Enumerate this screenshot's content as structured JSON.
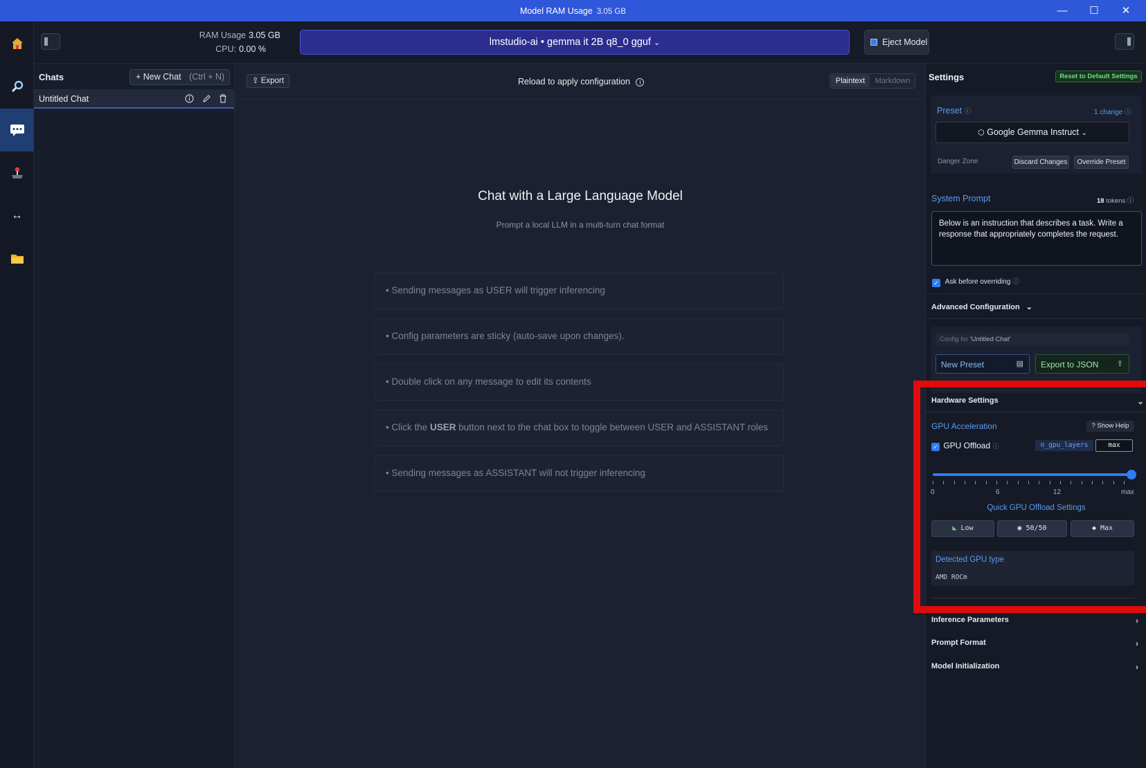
{
  "window": {
    "title": "Model RAM Usage",
    "title_value": "3.05 GB",
    "minimize": "—",
    "maximize": "☐",
    "close": "✕"
  },
  "topbar": {
    "ram_label": "RAM Usage",
    "ram_value": "3.05 GB",
    "cpu_label": "CPU:",
    "cpu_value": "0.00 %",
    "model": "lmstudio-ai • gemma it 2B q8_0 gguf",
    "eject": "Eject Model"
  },
  "chats": {
    "title": "Chats",
    "new_chat": "+ New Chat",
    "shortcut": "(Ctrl + N)",
    "items": [
      {
        "label": "Untitled Chat"
      }
    ]
  },
  "center": {
    "export": "Export",
    "reload": "Reload to apply configuration",
    "plaintext": "Plaintext",
    "markdown": "Markdown",
    "heading": "Chat with a Large Language Model",
    "subheading": "Prompt a local LLM in a multi-turn chat format",
    "tip1": "• Sending messages as USER will trigger inferencing",
    "tip2": "• Config parameters are sticky (auto-save upon changes).",
    "tip3": "• Double click on any message to edit its contents",
    "tip4_a": "• Click the ",
    "tip4_b": "USER",
    "tip4_c": " button next to the chat box to toggle between USER and ASSISTANT roles",
    "tip5": "• Sending messages as ASSISTANT will not trigger inferencing"
  },
  "settings": {
    "title": "Settings",
    "reset": "Reset to Default Settings",
    "preset_label": "Preset",
    "changes": "1 change",
    "preset_value": "Google Gemma Instruct",
    "danger_zone": "Danger Zone",
    "discard": "Discard Changes",
    "override": "Override Preset",
    "system_prompt_label": "System Prompt",
    "tokens_count": "18",
    "tokens_label": "tokens",
    "system_prompt": "Below is an instruction that describes a task. Write a response that appropriately completes the request.",
    "ask_before": "Ask before overriding",
    "advanced": "Advanced Configuration",
    "config_for": "Config for",
    "config_name": "'Untitled Chat'",
    "new_preset": "New Preset",
    "export_json": "Export to JSON",
    "hardware": "Hardware Settings",
    "gpu_accel": "GPU Acceleration",
    "show_help": "Show Help",
    "gpu_offload": "GPU Offload",
    "n_gpu_layers": "n_gpu_layers",
    "n_gpu_value": "max",
    "slider_fraction": 1.0,
    "ticks": [
      "0",
      "6",
      "12",
      "max"
    ],
    "quick_title": "Quick GPU Offload Settings",
    "low": "Low",
    "half": "50/50",
    "max": "Max",
    "detected_label": "Detected GPU type",
    "detected_value": "AMD ROCm",
    "inference": "Inference Parameters",
    "prompt_format": "Prompt Format",
    "model_init": "Model Initialization"
  },
  "colors": {
    "accent": "#2f57d9",
    "highlight": "#e00b0b",
    "link": "#5b9cf0"
  },
  "icons": [
    "home-icon",
    "search-icon",
    "chat-icon",
    "joystick-icon",
    "arrows-icon",
    "folder-icon"
  ]
}
